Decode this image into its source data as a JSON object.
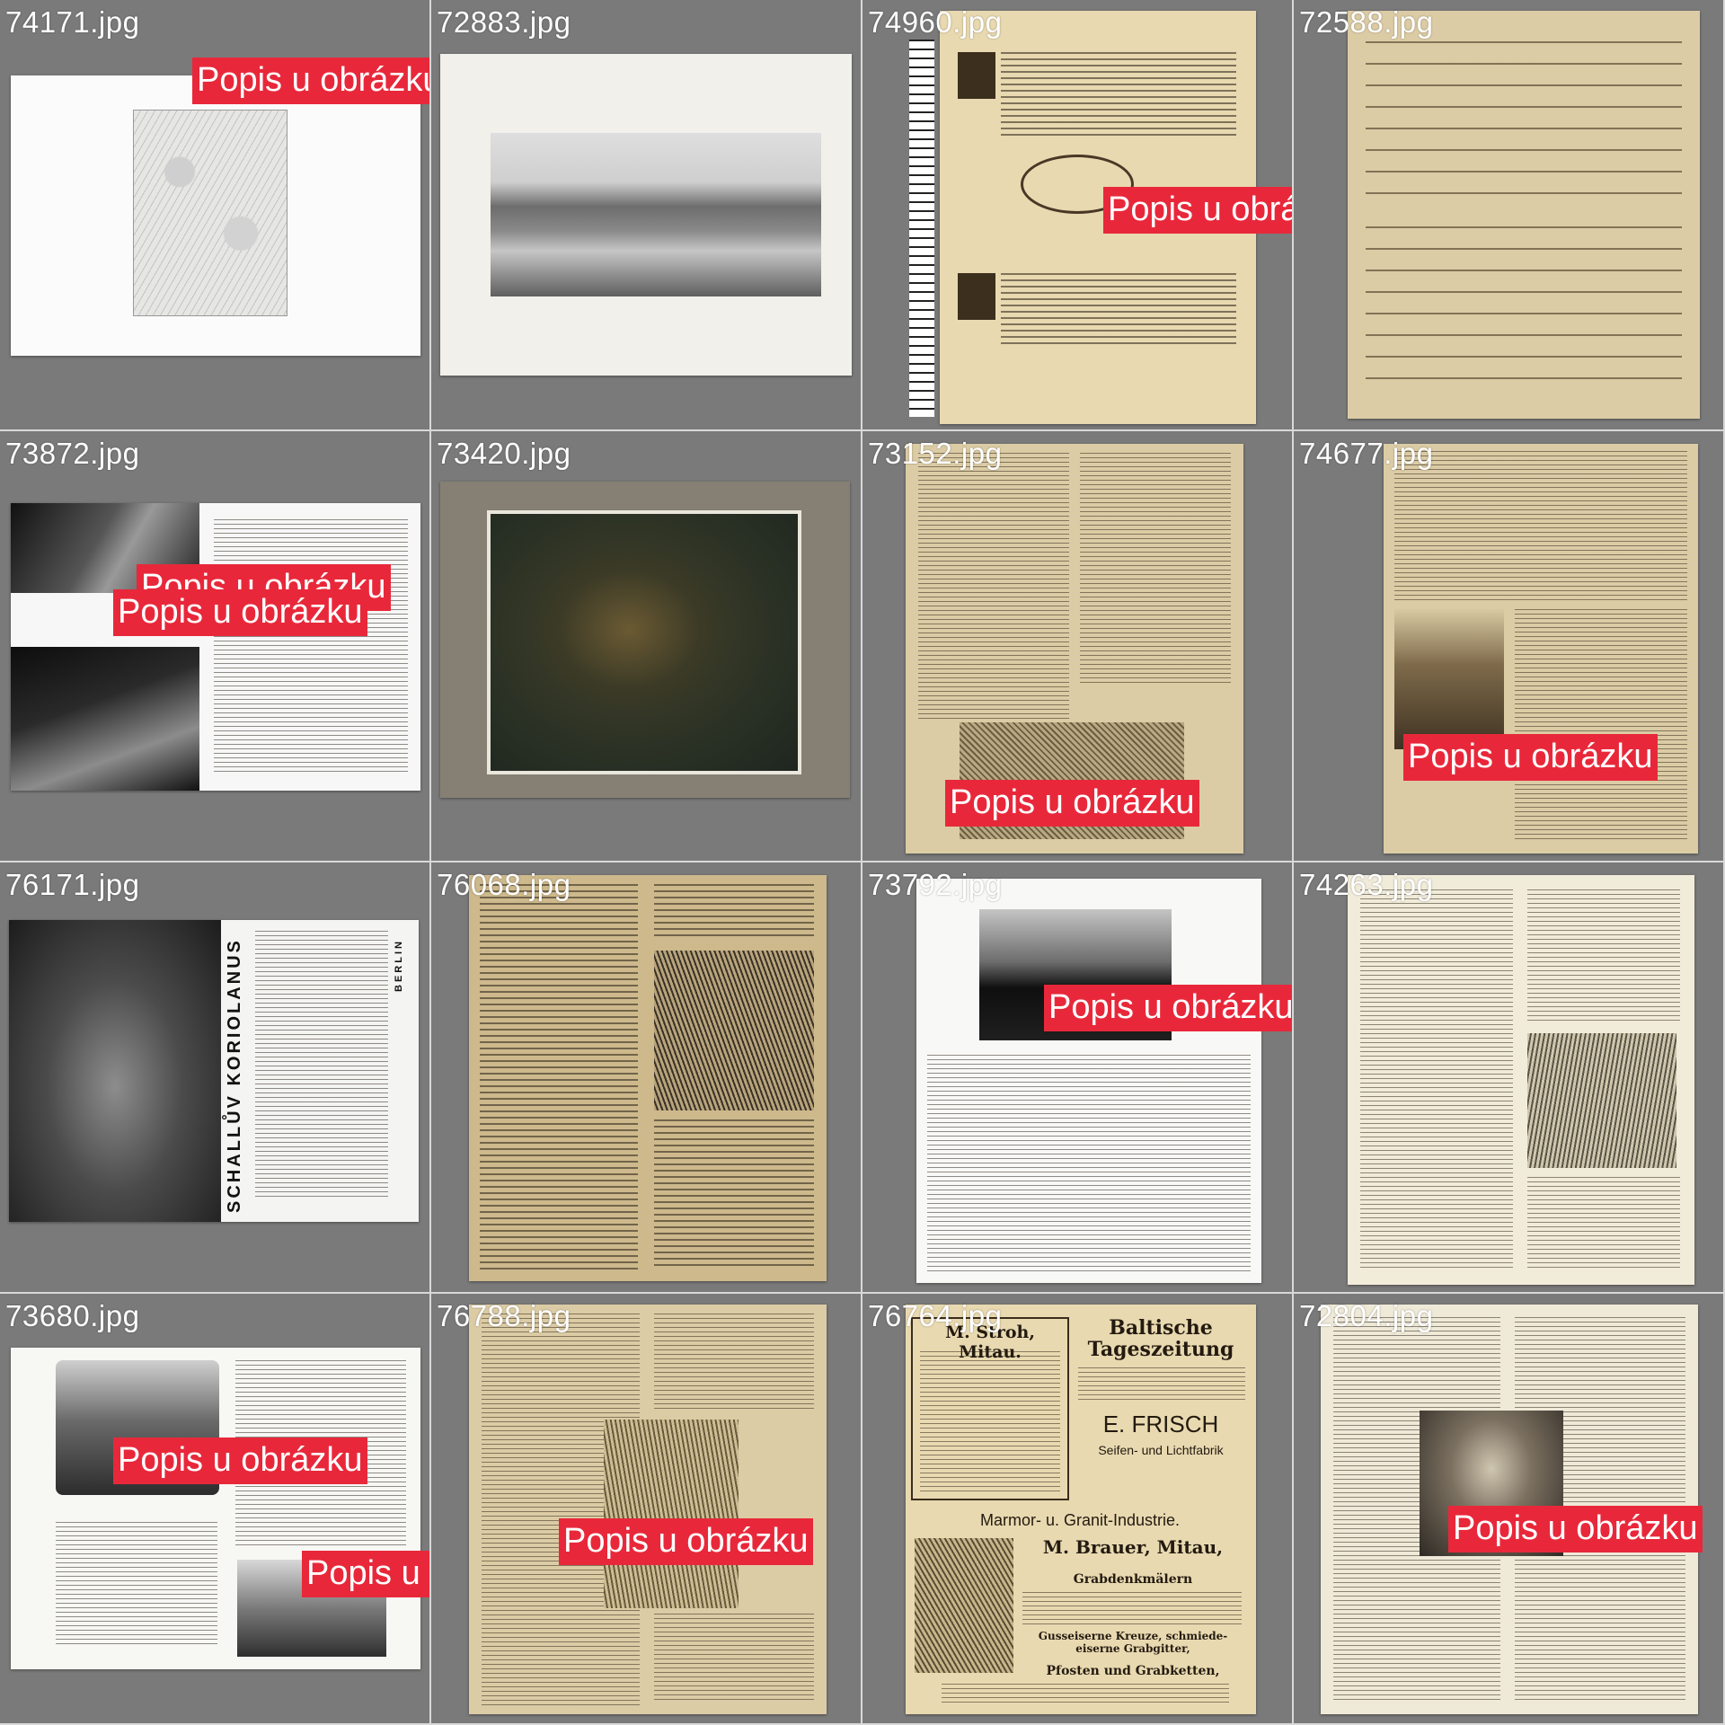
{
  "badge_text": "Popis u obrázku",
  "tiles": [
    {
      "file": "74171.jpg"
    },
    {
      "file": "72883.jpg"
    },
    {
      "file": "74960.jpg"
    },
    {
      "file": "72588.jpg"
    },
    {
      "file": "73872.jpg"
    },
    {
      "file": "73420.jpg"
    },
    {
      "file": "73152.jpg"
    },
    {
      "file": "74677.jpg"
    },
    {
      "file": "76171.jpg",
      "vertical_title": "SCHALLŮV KORIOLANUS",
      "side_label": "BERLIN"
    },
    {
      "file": "76068.jpg"
    },
    {
      "file": "73792.jpg"
    },
    {
      "file": "74263.jpg"
    },
    {
      "file": "73680.jpg"
    },
    {
      "file": "76788.jpg"
    },
    {
      "file": "76764.jpg",
      "ad": {
        "shop_name": "M. Stroh, Mitau.",
        "newspaper": "Baltische Tageszeitung",
        "company": "E. FRISCH",
        "product": "Seifen- und Lichtfabrik",
        "marble_heading": "Marmor- u. Granit-Industrie.",
        "marble_company": "M. Brauer, Mitau,",
        "grave": "Grabdenkmälern",
        "crosses": "Gusseiserne Kreuze, schmiede-eiserne Grabgitter,",
        "posts": "Pfosten und Grabketten,"
      }
    },
    {
      "file": "72804.jpg"
    }
  ]
}
